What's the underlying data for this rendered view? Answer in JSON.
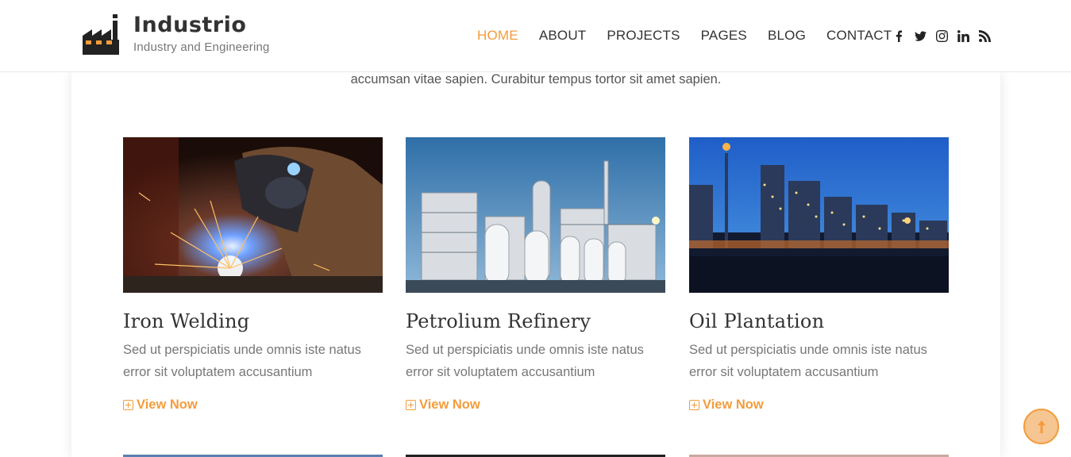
{
  "brand": {
    "name": "Industrio",
    "tagline": "Industry and Engineering"
  },
  "nav": {
    "items": [
      {
        "label": "HOME",
        "active": true
      },
      {
        "label": "ABOUT",
        "active": false
      },
      {
        "label": "PROJECTS",
        "active": false
      },
      {
        "label": "PAGES",
        "active": false
      },
      {
        "label": "BLOG",
        "active": false
      },
      {
        "label": "CONTACT",
        "active": false
      }
    ]
  },
  "social": [
    "facebook-icon",
    "twitter-icon",
    "instagram-icon",
    "linkedin-icon",
    "rss-icon"
  ],
  "intro_text": "accumsan vitae sapien. Curabitur tempus tortor sit amet sapien.",
  "cards": [
    {
      "title": "Iron Welding",
      "text": "Sed ut perspiciatis unde omnis iste natus error sit voluptatem accusantium",
      "link": "View Now",
      "image": "welding-photo"
    },
    {
      "title": "Petrolium Refinery",
      "text": "Sed ut perspiciatis unde omnis iste natus error sit voluptatem accusantium",
      "link": "View Now",
      "image": "refinery-photo"
    },
    {
      "title": "Oil Plantation",
      "text": "Sed ut perspiciatis unde omnis iste natus error sit voluptatem accusantium",
      "link": "View Now",
      "image": "oil-plant-photo"
    }
  ],
  "colors": {
    "accent": "#f39c3c",
    "text": "#333333",
    "muted": "#777777"
  }
}
